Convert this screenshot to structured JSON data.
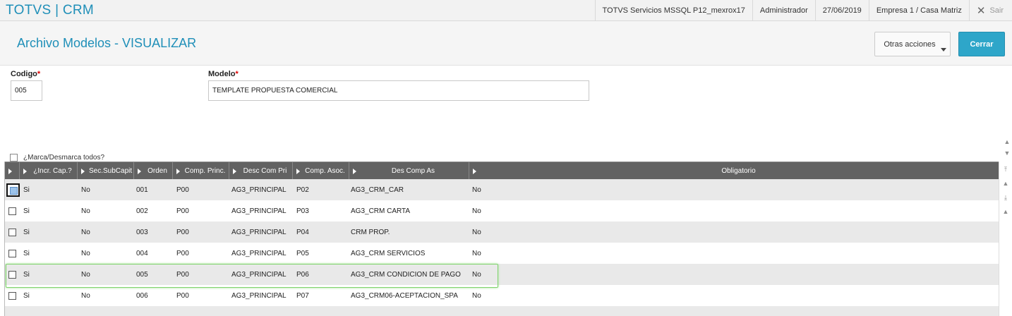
{
  "topbar": {
    "brand": "TOTVS | CRM",
    "environment": "TOTVS Servicios MSSQL P12_mexrox17",
    "user": "Administrador",
    "date": "27/06/2019",
    "company": "Empresa 1 / Casa Matriz",
    "exit_label": "Sair"
  },
  "header": {
    "title": "Archivo Modelos - VISUALIZAR",
    "other_actions_label": "Otras acciones",
    "close_label": "Cerrar"
  },
  "form": {
    "codigo_label": "Codigo",
    "codigo_value": "005",
    "modelo_label": "Modelo",
    "modelo_value": "TEMPLATE PROPUESTA COMERCIAL",
    "required_mark": "*"
  },
  "grid": {
    "select_all_label": "¿Marca/Desmarca todos?",
    "columns": [
      "¿Incr. Cap.?",
      "Sec.SubCapit",
      "Orden",
      "Comp. Princ.",
      "Desc Com Pri",
      "Comp. Asoc.",
      "Des Comp As",
      "Obligatorio"
    ],
    "rows": [
      {
        "incr": "Si",
        "sec": "No",
        "orden": "001",
        "comp_princ": "P00",
        "desc_pri": "AG3_PRINCIPAL",
        "comp_asoc": "P02",
        "des_as": "AG3_CRM_CAR",
        "oblig": "No"
      },
      {
        "incr": "Si",
        "sec": "No",
        "orden": "002",
        "comp_princ": "P00",
        "desc_pri": "AG3_PRINCIPAL",
        "comp_asoc": "P03",
        "des_as": "AG3_CRM CARTA",
        "oblig": "No"
      },
      {
        "incr": "Si",
        "sec": "No",
        "orden": "003",
        "comp_princ": "P00",
        "desc_pri": "AG3_PRINCIPAL",
        "comp_asoc": "P04",
        "des_as": "CRM PROP.",
        "oblig": "No"
      },
      {
        "incr": "Si",
        "sec": "No",
        "orden": "004",
        "comp_princ": "P00",
        "desc_pri": "AG3_PRINCIPAL",
        "comp_asoc": "P05",
        "des_as": "AG3_CRM SERVICIOS",
        "oblig": "No"
      },
      {
        "incr": "Si",
        "sec": "No",
        "orden": "005",
        "comp_princ": "P00",
        "desc_pri": "AG3_PRINCIPAL",
        "comp_asoc": "P06",
        "des_as": "AG3_CRM CONDICION DE PAGO",
        "oblig": "No"
      },
      {
        "incr": "Si",
        "sec": "No",
        "orden": "006",
        "comp_princ": "P00",
        "desc_pri": "AG3_PRINCIPAL",
        "comp_asoc": "P07",
        "des_as": "AG3_CRM06-ACEPTACION_SPA",
        "oblig": "No"
      }
    ]
  },
  "colors": {
    "brand": "#1f8fb8",
    "primary_button": "#2ea6c9",
    "grid_header": "#626262",
    "highlight": "#7fd36c"
  }
}
